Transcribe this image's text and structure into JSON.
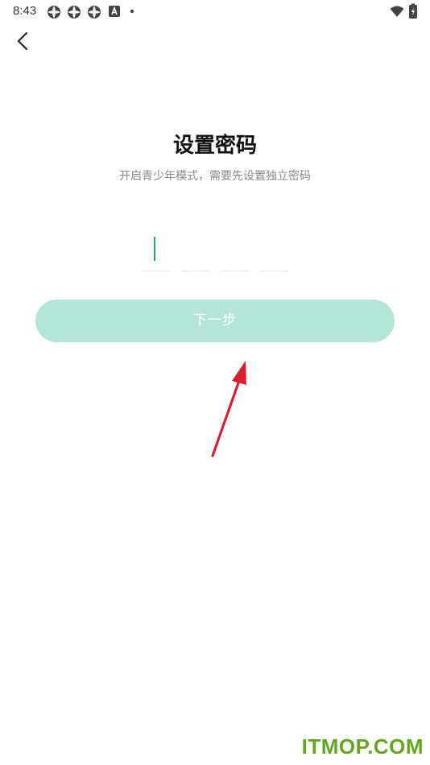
{
  "status_bar": {
    "time": "8:43",
    "icons": [
      "app-notification-icon",
      "app-notification-icon",
      "app-notification-icon",
      "a-notification-icon",
      "dot-indicator-icon",
      "wifi-icon",
      "battery-icon"
    ]
  },
  "header": {
    "back_icon": "chevron-left-icon"
  },
  "main": {
    "title": "设置密码",
    "subtitle": "开启青少年模式，需要先设置独立密码",
    "pin_length": 4,
    "next_label": "下一步"
  },
  "colors": {
    "accent": "#1aa388",
    "button_disabled": "#b3e5d9",
    "annotation_arrow": "#d9202a",
    "watermark": "#62a71f"
  },
  "watermark": {
    "text": "ITMOP.COM"
  }
}
